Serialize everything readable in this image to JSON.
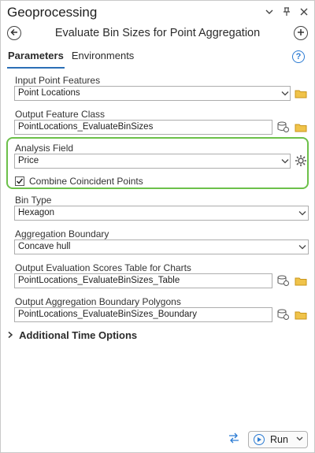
{
  "window": {
    "title": "Geoprocessing"
  },
  "tool": {
    "title": "Evaluate Bin Sizes for Point Aggregation"
  },
  "tabs": [
    {
      "label": "Parameters",
      "active": true
    },
    {
      "label": "Environments",
      "active": false
    }
  ],
  "help": {
    "glyph": "?"
  },
  "params": {
    "input_point_features": {
      "label": "Input Point Features",
      "value": "Point Locations"
    },
    "output_feature_class": {
      "label": "Output Feature Class",
      "value": "PointLocations_EvaluateBinSizes"
    },
    "analysis_field": {
      "label": "Analysis Field",
      "value": "Price"
    },
    "combine_coincident": {
      "label": "Combine Coincident Points",
      "checked": true
    },
    "bin_type": {
      "label": "Bin Type",
      "value": "Hexagon"
    },
    "aggregation_boundary": {
      "label": "Aggregation Boundary",
      "value": "Concave hull"
    },
    "output_scores_table": {
      "label": "Output Evaluation Scores Table for Charts",
      "value": "PointLocations_EvaluateBinSizes_Table"
    },
    "output_boundary_polygons": {
      "label": "Output Aggregation Boundary Polygons",
      "value": "PointLocations_EvaluateBinSizes_Boundary"
    }
  },
  "sections": {
    "additional_time_options": "Additional Time Options"
  },
  "run": {
    "label": "Run"
  },
  "colors": {
    "accent": "#2b7bd3",
    "highlight": "#6cc04a",
    "folder": "#e6b32e"
  }
}
